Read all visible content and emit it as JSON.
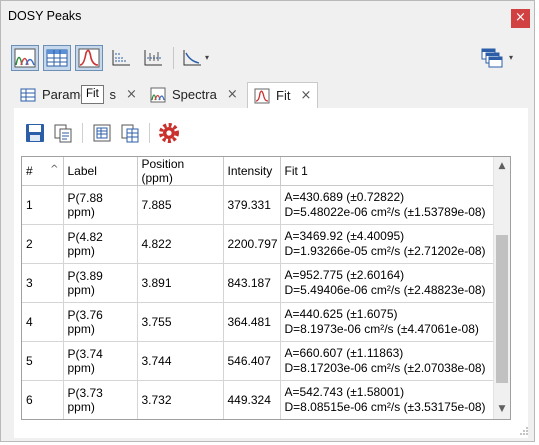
{
  "window": {
    "title": "DOSY Peaks",
    "close_glyph": "×"
  },
  "toolbar": {
    "buttons": [
      {
        "icon": "spectrum-overlay-icon",
        "active": true
      },
      {
        "icon": "table-view-icon",
        "active": true
      },
      {
        "icon": "fit-curve-icon",
        "active": true
      },
      {
        "icon": "decay-plot-icon",
        "active": false
      },
      {
        "icon": "peak-plot-icon",
        "active": false
      },
      {
        "icon": "axis-plot-icon",
        "active": false
      }
    ],
    "dropdown_glyph": "▾",
    "windows_icon": "windows-stack-icon"
  },
  "tabs": [
    {
      "label": "Parame",
      "label_tail": "s",
      "icon": "grid-icon",
      "close": "×"
    },
    {
      "label": "Spectra",
      "icon": "spectra-icon",
      "close": "×"
    },
    {
      "label": "Fit",
      "icon": "fit-icon",
      "close": "×"
    }
  ],
  "tooltip": "Fit",
  "actions": [
    {
      "icon": "save-icon"
    },
    {
      "icon": "copy-icon"
    },
    {
      "icon": "export-table-icon"
    },
    {
      "icon": "copy-table-icon"
    },
    {
      "icon": "settings-gear-icon"
    }
  ],
  "table": {
    "columns": [
      "#",
      "Label",
      "Position (ppm)",
      "Intensity",
      "Fit 1"
    ],
    "sort_glyph": "^",
    "rows": [
      {
        "num": "1",
        "label": "P(7.88 ppm)",
        "position": "7.885",
        "intensity": "379.331",
        "fit_a": "A=430.689 (±0.72822)",
        "fit_d": "D=5.48022e-06 cm²/s (±1.53789e-08)"
      },
      {
        "num": "2",
        "label": "P(4.82 ppm)",
        "position": "4.822",
        "intensity": "2200.797",
        "fit_a": "A=3469.92 (±4.40095)",
        "fit_d": "D=1.93266e-05 cm²/s (±2.71202e-08)"
      },
      {
        "num": "3",
        "label": "P(3.89 ppm)",
        "position": "3.891",
        "intensity": "843.187",
        "fit_a": "A=952.775 (±2.60164)",
        "fit_d": "D=5.49406e-06 cm²/s (±2.48823e-08)"
      },
      {
        "num": "4",
        "label": "P(3.76 ppm)",
        "position": "3.755",
        "intensity": "364.481",
        "fit_a": "A=440.625 (±1.6075)",
        "fit_d": "D=8.1973e-06 cm²/s (±4.47061e-08)"
      },
      {
        "num": "5",
        "label": "P(3.74 ppm)",
        "position": "3.744",
        "intensity": "546.407",
        "fit_a": "A=660.607 (±1.11863)",
        "fit_d": "D=8.17203e-06 cm²/s (±2.07038e-08)"
      },
      {
        "num": "6",
        "label": "P(3.73 ppm)",
        "position": "3.732",
        "intensity": "449.324",
        "fit_a": "A=542.743 (±1.58001)",
        "fit_d": "D=8.08515e-06 cm²/s (±3.53175e-08)"
      }
    ]
  },
  "scrollbar": {
    "up": "▲",
    "down": "▼"
  },
  "colors": {
    "active_button": "#c6d8ec",
    "close_red": "#d14141",
    "settings_red": "#c9302c"
  }
}
